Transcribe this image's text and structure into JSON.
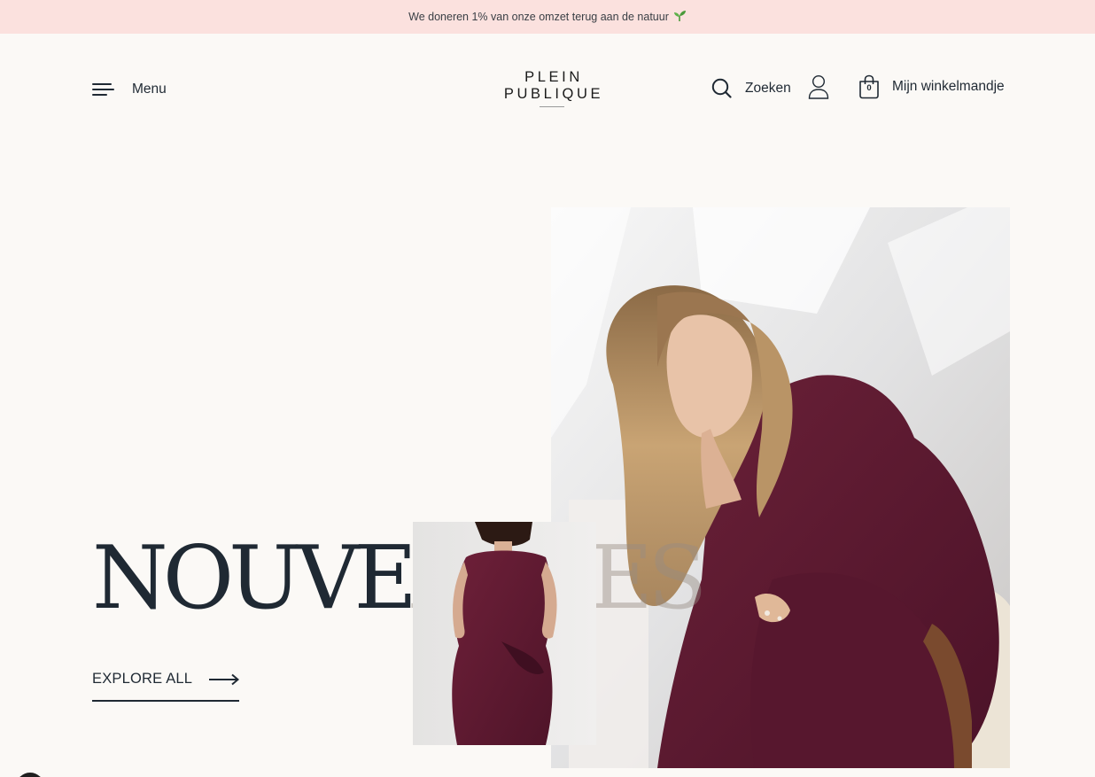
{
  "announcement": {
    "text": "We doneren 1% van onze omzet terug aan de natuur",
    "emoji_icon": "seedling-icon"
  },
  "header": {
    "menu_label": "Menu",
    "logo_line1": "PLEIN",
    "logo_line2": "PUBLIQUE",
    "search_label": "Zoeken",
    "cart_count": "0",
    "cart_label": "Mijn winkelmandje"
  },
  "hero": {
    "title_dark": "NOUVE",
    "title_light": "AUTES",
    "cta_label": "EXPLORE ALL"
  },
  "colors": {
    "announcement_bg": "#fbe1de",
    "page_bg": "#fbf9f6",
    "text": "#1f2933",
    "garment": "#5e1a33"
  }
}
